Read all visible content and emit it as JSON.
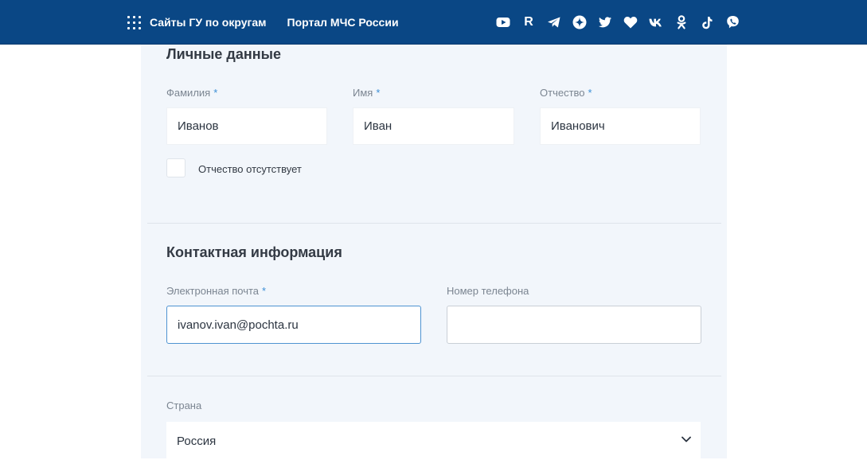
{
  "header": {
    "menu_icon": "grid-icon",
    "link_districts": "Сайты ГУ по округам",
    "link_portal": "Портал МЧС России",
    "socials": [
      {
        "icon": "youtube-icon"
      },
      {
        "icon": "rutube-icon",
        "glyph": "R"
      },
      {
        "icon": "telegram-icon"
      },
      {
        "icon": "dzen-icon"
      },
      {
        "icon": "twitter-icon"
      },
      {
        "icon": "heart-icon"
      },
      {
        "icon": "vk-icon"
      },
      {
        "icon": "odnoklassniki-icon"
      },
      {
        "icon": "tiktok-icon"
      },
      {
        "icon": "viber-icon"
      }
    ],
    "colors": {
      "background": "#0a4785",
      "text": "#ffffff"
    }
  },
  "personal": {
    "title": "Личные данные",
    "surname": {
      "label": "Фамилия",
      "required_mark": "*",
      "value": "Иванов"
    },
    "name": {
      "label": "Имя",
      "required_mark": "*",
      "value": "Иван"
    },
    "patronymic": {
      "label": "Отчество",
      "required_mark": "*",
      "value": "Иванович"
    },
    "no_patronymic_label": "Отчество отсутствует",
    "no_patronymic_checked": false
  },
  "contact": {
    "title": "Контактная информация",
    "email": {
      "label": "Электронная почта",
      "required_mark": "*",
      "value": "ivanov.ivan@pochta.ru"
    },
    "phone": {
      "label": "Номер телефона",
      "value": ""
    }
  },
  "location": {
    "country": {
      "label": "Страна",
      "value": "Россия"
    }
  },
  "colors": {
    "card_background": "#f2f6fb",
    "required_mark": "#3d8fd6",
    "focus_border": "#4e93d1"
  }
}
